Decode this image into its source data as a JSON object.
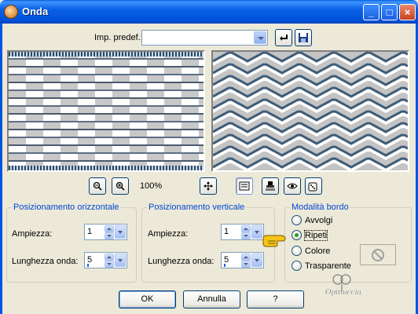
{
  "window": {
    "title": "Onda",
    "icon": "paint-shop-pro-app-icon",
    "controls": {
      "minimize": "_",
      "maximize": "□",
      "close": "×"
    }
  },
  "preset": {
    "label": "Imp. predef.:",
    "value": "",
    "reset_icon": "reset-arrow-icon",
    "save_icon": "floppy-disk-icon"
  },
  "zoom": {
    "value": "100%",
    "icons": [
      "zoom-out-icon",
      "zoom-in-icon",
      "move-icon",
      "proof-toggle-icon",
      "stamp-icon",
      "eye-icon",
      "randomize-dice-icon"
    ]
  },
  "horizontal": {
    "title": "Posizionamento orizzontale",
    "amplitude_label": "Ampiezza:",
    "amplitude_value": "1",
    "wavelength_label": "Lunghezza onda:",
    "wavelength_value": "5"
  },
  "vertical": {
    "title": "Posizionamento verticale",
    "amplitude_label": "Ampiezza:",
    "amplitude_value": "1",
    "wavelength_label": "Lunghezza onda:",
    "wavelength_value": "5"
  },
  "edge_mode": {
    "title": "Modalità bordo",
    "options": [
      "Avvolgi",
      "Ripeti",
      "Colore",
      "Trasparente"
    ],
    "selected": "Ripeti"
  },
  "buttons": {
    "ok": "OK",
    "cancel": "Annulla",
    "help": "?"
  },
  "watermark": {
    "text": "Opinuccia"
  },
  "colors": {
    "accent_title": "#0046D5",
    "titlebar": "#0A61E6",
    "face": "#ECE9D8"
  }
}
